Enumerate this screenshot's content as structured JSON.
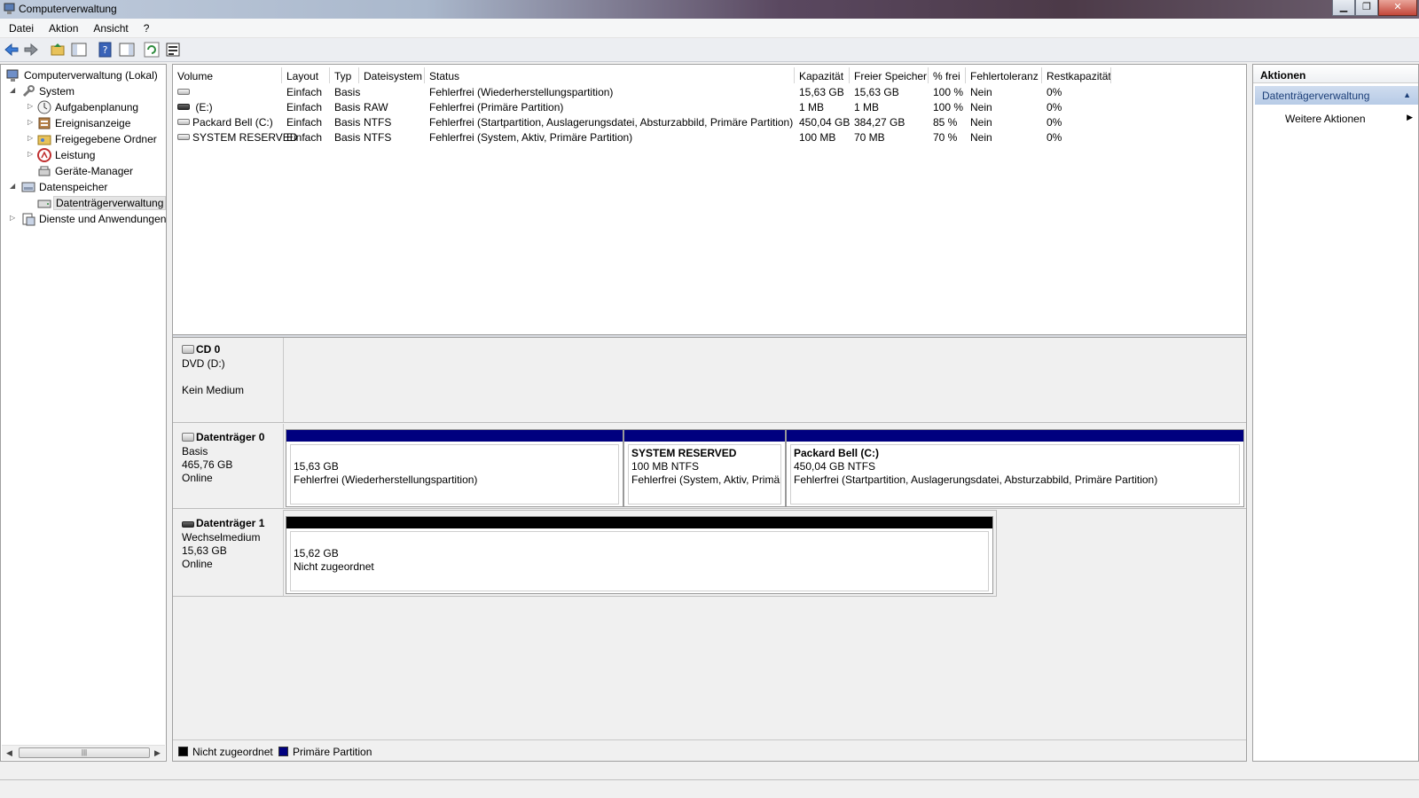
{
  "window": {
    "title": "Computerverwaltung"
  },
  "menu": [
    "Datei",
    "Aktion",
    "Ansicht",
    "?"
  ],
  "tree": {
    "root": "Computerverwaltung (Lokal)",
    "system": "System",
    "aufgaben": "Aufgabenplanung",
    "ereignis": "Ereignisanzeige",
    "ordner": "Freigegebene Ordner",
    "leistung": "Leistung",
    "geraete": "Geräte-Manager",
    "datenspeicher": "Datenspeicher",
    "datentraeger": "Datenträgerverwaltung",
    "dienste": "Dienste und Anwendungen"
  },
  "volumes": {
    "headers": [
      "Volume",
      "Layout",
      "Typ",
      "Dateisystem",
      "Status",
      "Kapazität",
      "Freier Speicher",
      "% frei",
      "Fehlertoleranz",
      "Restkapazität"
    ],
    "rows": [
      [
        "",
        "Einfach",
        "Basis",
        "",
        "Fehlerfrei (Wiederherstellungspartition)",
        "15,63 GB",
        "15,63 GB",
        "100 %",
        "Nein",
        "0%"
      ],
      [
        "(E:)",
        "Einfach",
        "Basis",
        "RAW",
        "Fehlerfrei (Primäre Partition)",
        "1 MB",
        "1 MB",
        "100 %",
        "Nein",
        "0%"
      ],
      [
        "Packard Bell (C:)",
        "Einfach",
        "Basis",
        "NTFS",
        "Fehlerfrei (Startpartition, Auslagerungsdatei, Absturzabbild, Primäre Partition)",
        "450,04 GB",
        "384,27 GB",
        "85 %",
        "Nein",
        "0%"
      ],
      [
        "SYSTEM RESERVED",
        "Einfach",
        "Basis",
        "NTFS",
        "Fehlerfrei (System, Aktiv, Primäre Partition)",
        "100 MB",
        "70 MB",
        "70 %",
        "Nein",
        "0%"
      ]
    ]
  },
  "disks": {
    "cd0": {
      "name": "CD 0",
      "type": "DVD (D:)",
      "status": "Kein Medium"
    },
    "disk0": {
      "name": "Datenträger 0",
      "type": "Basis",
      "size": "465,76 GB",
      "status": "Online",
      "partitions": [
        {
          "title": "",
          "size": "15,63 GB",
          "status": "Fehlerfrei (Wiederherstellungspartition)"
        },
        {
          "title": "SYSTEM RESERVED",
          "size": "100 MB NTFS",
          "status": "Fehlerfrei (System, Aktiv, Primär"
        },
        {
          "title": "Packard Bell  (C:)",
          "size": "450,04 GB NTFS",
          "status": "Fehlerfrei (Startpartition, Auslagerungsdatei, Absturzabbild, Primäre Partition)"
        }
      ]
    },
    "disk1": {
      "name": "Datenträger 1",
      "type": "Wechselmedium",
      "size": "15,63 GB",
      "status": "Online",
      "partitions": [
        {
          "size": "15,62 GB",
          "status": "Nicht zugeordnet"
        }
      ]
    }
  },
  "legend": {
    "unallocated": "Nicht zugeordnet",
    "primary": "Primäre Partition"
  },
  "actions": {
    "title": "Aktionen",
    "group": "Datenträgerverwaltung",
    "more": "Weitere Aktionen"
  },
  "colors": {
    "primary_partition": "#00007f",
    "unallocated": "#000000",
    "selection": "#b7cbe6"
  }
}
